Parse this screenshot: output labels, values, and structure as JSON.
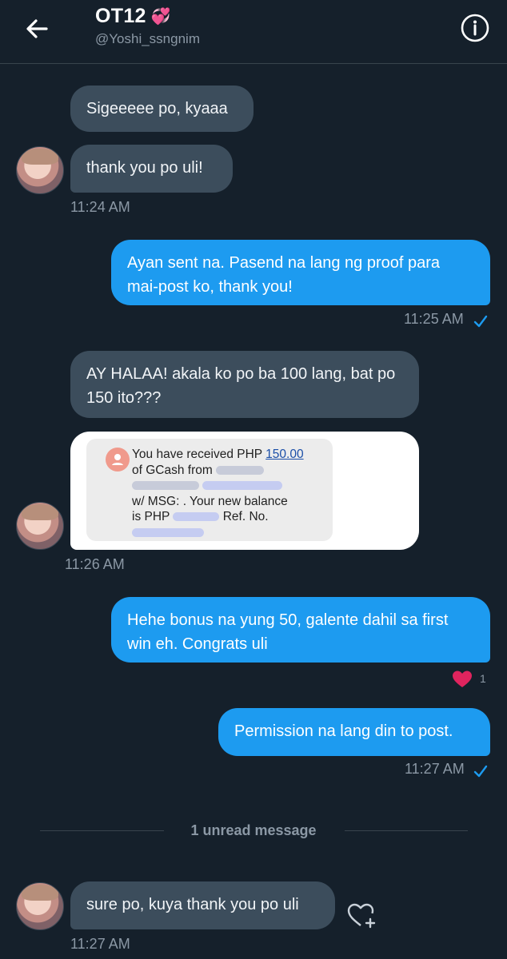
{
  "header": {
    "name": "OT12",
    "name_emoji": "💞",
    "handle": "@Yoshi_ssngnim",
    "back_icon": "back-arrow-icon",
    "info_icon": "info-icon"
  },
  "messages": [
    {
      "dir": "in",
      "text": "Sigeeeee po, kyaaa"
    },
    {
      "dir": "in",
      "text": "thank you po uli!"
    },
    {
      "dir": "in",
      "time": "11:24 AM"
    },
    {
      "dir": "out",
      "text": "Ayan sent na. Pasend na lang ng proof para mai-post ko, thank you!",
      "time": "11:25 AM",
      "status": "✓"
    },
    {
      "dir": "in",
      "text": "AY HALAA! akala ko po ba 100 lang, bat po 150 ito???"
    },
    {
      "dir": "in",
      "image": {
        "line1": "You have received PHP ",
        "amount": "150.00",
        "line2": "of GCash from",
        "line4": "w/ MSG: . Your new balance",
        "line5a": "is PHP",
        "line5b": "Ref. No."
      },
      "time": "11:26 AM"
    },
    {
      "dir": "out",
      "text": "Hehe bonus na yung 50, galente dahil sa first win eh. Congrats uli",
      "reaction": {
        "icon": "heart-icon",
        "count": "1",
        "color": "#e0245e"
      }
    },
    {
      "dir": "out",
      "text": "Permission na lang din to post.",
      "time": "11:27 AM",
      "status": "✓"
    },
    {
      "dir": "in",
      "text": "sure po, kuya thank you po uli",
      "time": "11:27 AM"
    }
  ],
  "divider": {
    "text": "1 unread message"
  },
  "colors": {
    "background": "#15202b",
    "incoming": "#3c4d5c",
    "outgoing": "#1d9bf0",
    "muted": "#8b98a5"
  }
}
